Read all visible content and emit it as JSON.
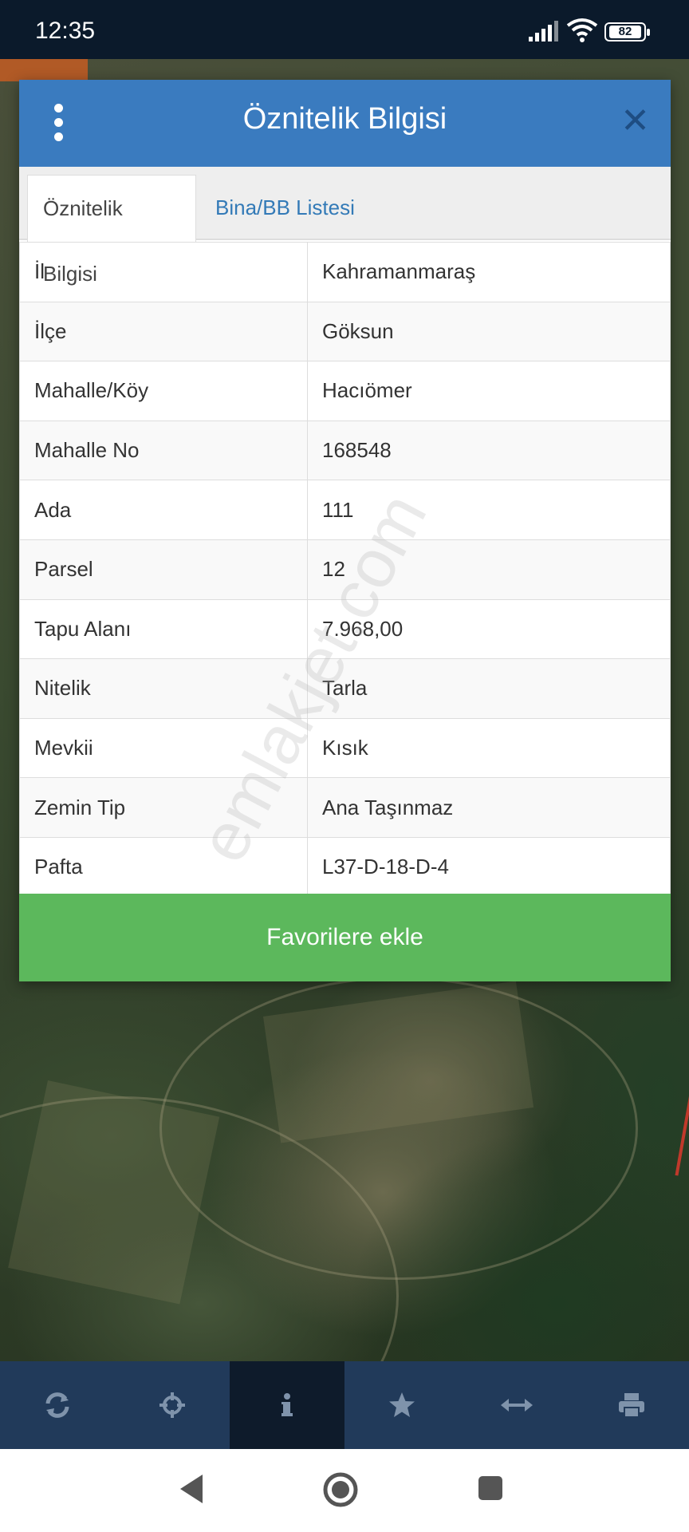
{
  "status_bar": {
    "time": "12:35",
    "battery": "82"
  },
  "dialog": {
    "title": "Öznitelik Bilgisi",
    "tabs": [
      {
        "label": "Öznitelik Bilgisi",
        "active": true
      },
      {
        "label": "Bina/BB Listesi",
        "active": false
      }
    ],
    "rows": [
      {
        "key": "İl",
        "value": "Kahramanmaraş"
      },
      {
        "key": "İlçe",
        "value": "Göksun"
      },
      {
        "key": "Mahalle/Köy",
        "value": "Hacıömer"
      },
      {
        "key": "Mahalle No",
        "value": "168548"
      },
      {
        "key": "Ada",
        "value": "111"
      },
      {
        "key": "Parsel",
        "value": "12"
      },
      {
        "key": "Tapu Alanı",
        "value": "7.968,00"
      },
      {
        "key": "Nitelik",
        "value": "Tarla"
      },
      {
        "key": "Mevkii",
        "value": "Kısık"
      },
      {
        "key": "Zemin Tip",
        "value": "Ana Taşınmaz"
      },
      {
        "key": "Pafta",
        "value": "L37-D-18-D-4"
      }
    ],
    "favorite_label": "Favorilere ekle"
  },
  "watermark": "emlakjet.com",
  "toolbar": {
    "items": [
      {
        "icon": "refresh-icon",
        "active": false
      },
      {
        "icon": "crosshair-icon",
        "active": false
      },
      {
        "icon": "info-icon",
        "active": true
      },
      {
        "icon": "star-icon",
        "active": false
      },
      {
        "icon": "measure-arrows-icon",
        "active": false
      },
      {
        "icon": "print-icon",
        "active": false
      }
    ]
  },
  "colors": {
    "header": "#3a7bbf",
    "favorite_button": "#5cb85c",
    "toolbar": "#213a5a",
    "tab_link": "#337ab7"
  }
}
